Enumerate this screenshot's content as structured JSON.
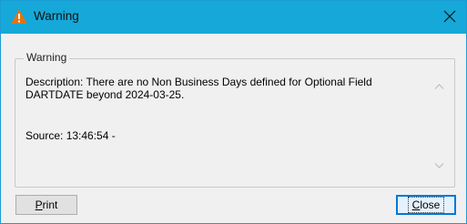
{
  "window": {
    "title": "Warning",
    "accent_color": "#16a8d8",
    "icon": "warning-icon",
    "close_icon": "close-icon"
  },
  "group": {
    "label": "Warning",
    "description": "Description: There are no Non Business Days defined for Optional Field DARTDATE beyond 2024-03-25.",
    "source": "Source:  13:46:54 -"
  },
  "buttons": {
    "print_first": "P",
    "print_rest": "rint",
    "close_first": "C",
    "close_rest": "lose"
  }
}
